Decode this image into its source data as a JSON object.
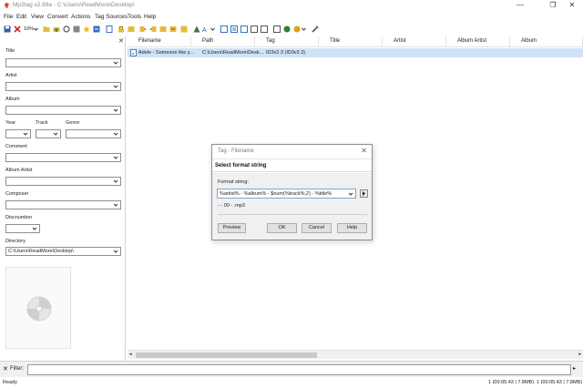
{
  "window": {
    "title": "Mp3tag v2.89a  -  C:\\Users\\ReadMore\\Desktop\\",
    "controls": [
      "—",
      "❐",
      "✕"
    ]
  },
  "menu": [
    "File",
    "Edit",
    "View",
    "Convert",
    "Actions",
    "Tag Sources",
    "Tools",
    "Help"
  ],
  "toolbar": {
    "icons": [
      "save-icon",
      "remove-tag-icon",
      "undo-icon",
      "open-folder-icon",
      "add-folder-icon",
      "refresh-icon",
      "favorite-icon",
      "options-icon",
      "tag-filename-icon",
      "filename-tag-icon",
      "text-file-icon",
      "lock-icon",
      "tag-tag-icon",
      "actions-icon",
      "export-icon",
      "playlist-icon",
      "playlist-all-icon",
      "tag-sources-icon",
      "web-sources-icon",
      "tools-icon"
    ],
    "speed_label": "10%"
  },
  "sidebar": {
    "fields": [
      {
        "label": "Title",
        "value": ""
      },
      {
        "label": "Artist",
        "value": ""
      },
      {
        "label": "Album",
        "value": ""
      },
      {
        "label": "Year",
        "value": ""
      },
      {
        "label": "Track",
        "value": ""
      },
      {
        "label": "Genre",
        "value": ""
      },
      {
        "label": "Comment",
        "value": ""
      },
      {
        "label": "Album Artist",
        "value": ""
      },
      {
        "label": "Composer",
        "value": ""
      },
      {
        "label": "Discnumber",
        "value": ""
      },
      {
        "label": "Directory",
        "value": "C:\\Users\\ReadMore\\Desktop\\"
      }
    ]
  },
  "grid": {
    "columns": [
      "Filename",
      "Path",
      "Tag",
      "Title",
      "Artist",
      "Album Artist",
      "Album"
    ],
    "rows": [
      {
        "filename": "Adele - Someone like y...",
        "path": "C:\\Users\\ReadMore\\Desk...",
        "tag": "ID3v2.3 (ID3v2.3)",
        "title": "",
        "artist": "",
        "album_artist": "",
        "album": ""
      }
    ]
  },
  "filter": {
    "label": "Filter:",
    "value": ""
  },
  "status": {
    "left": "Ready",
    "selected": "1 (00:05:43 | 7.8MB)",
    "total": "1 (00:05:43 | 7.8MB)"
  },
  "dialog": {
    "title": "Tag - Filename",
    "heading": "Select format string",
    "format_label": "Format string:",
    "format_value": "%artist% - %album% - $num(%track%,2) - %title%",
    "preview": " -  - 00 - .mp3",
    "buttons": {
      "preview": "Preview",
      "ok": "OK",
      "cancel": "Cancel",
      "help": "Help"
    }
  }
}
